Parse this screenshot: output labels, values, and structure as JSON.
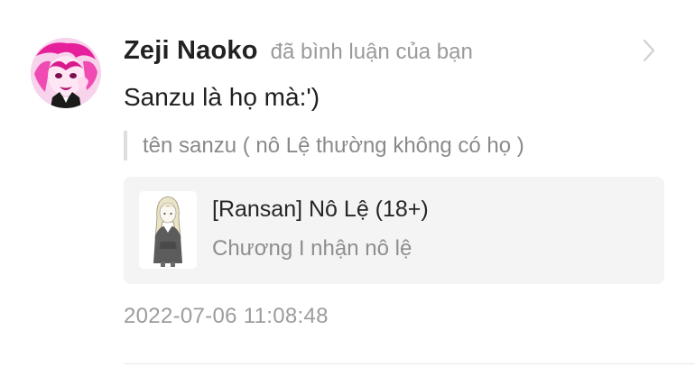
{
  "notification": {
    "username": "Zeji Naoko",
    "action": "đã bình luận của bạn",
    "comment": "Sanzu là họ mà:')",
    "quoted_reply": "tên sanzu ( nô Lệ thường không có họ )",
    "story": {
      "title": "[Ransan] Nô Lệ (18+)",
      "chapter": "Chương I nhận nô lệ"
    },
    "timestamp": "2022-07-06 11:08:48"
  },
  "icons": {
    "open": "chevron-right-icon"
  },
  "colors": {
    "avatar_accent": "#e6209a",
    "card_background": "#f4f4f4",
    "quote_bar": "#dedede"
  }
}
